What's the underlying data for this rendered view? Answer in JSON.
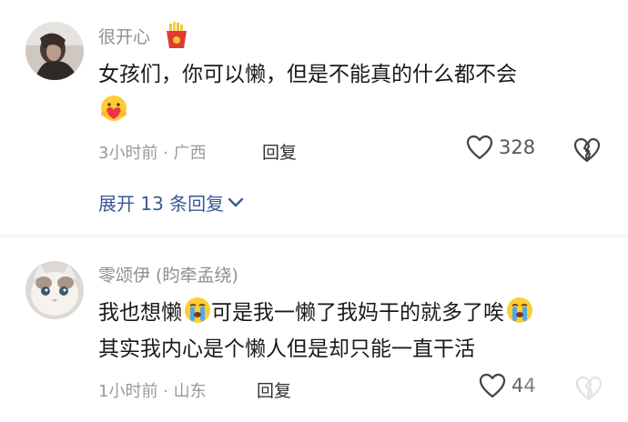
{
  "comments": [
    {
      "username": "很开心",
      "badge_icon": "fries-badge-icon",
      "text": "女孩们，你可以懒，但是不能真的什么都不会",
      "emoji": "hug-heart-emoji",
      "time": "3小时前",
      "location_sep": " · ",
      "location": "广西",
      "reply_label": "回复",
      "like_count": "328",
      "expand_label": "展开 13 条回复"
    },
    {
      "username": "零颂伊 (盷牵孟绕)",
      "line1_a": "我也想懒",
      "line1_b": "可是我一懒了我妈干的就多了唉",
      "line2": "其实我内心是个懒人但是却只能一直干活",
      "emoji": "crying-emoji",
      "time": "1小时前",
      "location_sep": " · ",
      "location": "山东",
      "reply_label": "回复",
      "like_count": "44"
    }
  ],
  "colors": {
    "link": "#3a5a95",
    "meta": "#9a9a9a",
    "username": "#8f8f8f"
  }
}
